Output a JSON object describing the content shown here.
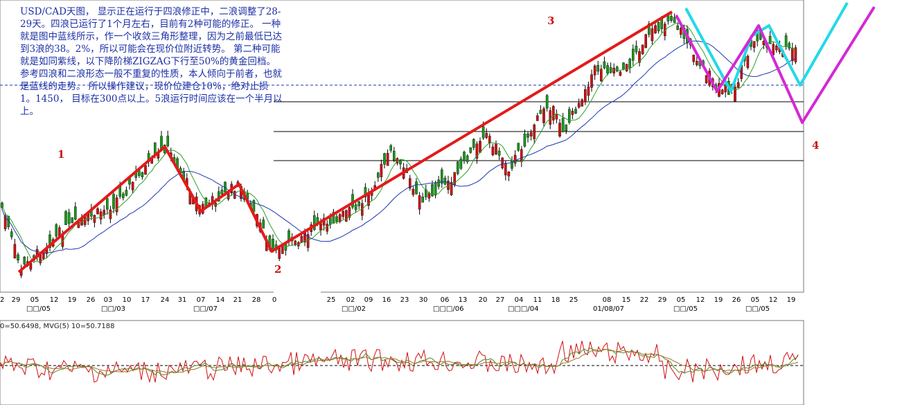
{
  "annotation": "USD/CAD天图， 显示正在运行于四浪修正中，二浪调整了28-29天。四浪已运行了1个月左右，目前有2种可能的修正。 一种就是图中蓝线所示，作一个收敛三角形整理，因为之前最低已达到3浪的38。2%，所以可能会在现价位附近转势。 第二种可能就是如同紫线，以下降阶梯ZIGZAG下行至50%的黄金回档。 参考四浪和二浪形态一般不重复的性质，本人倾向于前者，也就是蓝线的走势。 所以操作建议，现价位建仓10%，绝对止损1。1450， 目标在300点以上。5浪运行时间应该在一个半月以上。",
  "oscillator_label": "0=50.6498, MVG(5) 10=50.7188",
  "colors": {
    "wave": "#e31a1a",
    "cyan": "#22d9e8",
    "purple": "#d428d4",
    "bull": "#1a9a1a",
    "bear": "#d01010",
    "ma_green": "#2aa02a",
    "ma_blue": "#1a36b0"
  },
  "chart_data": {
    "type": "candlestick",
    "wave_labels": [
      "1",
      "2",
      "3",
      "4"
    ],
    "x_ticks": [
      "22",
      "29",
      "05",
      "12",
      "19",
      "26",
      "03",
      "10",
      "17",
      "24",
      "31",
      "07",
      "14",
      "21",
      "28",
      "0",
      "25",
      "02",
      "09",
      "16",
      "23",
      "30",
      "06",
      "13",
      "20",
      "27",
      "04",
      "11",
      "18",
      "25",
      "08",
      "15",
      "22",
      "29",
      "05",
      "12",
      "19",
      "26",
      "05",
      "12",
      "19"
    ],
    "month_labels": [
      "□□/05",
      "□□/03",
      "□□/07",
      "□□/02",
      "□□□/06",
      "□□□/04",
      "01/08/07",
      "□□/05",
      "□□/05"
    ],
    "grid": false
  }
}
